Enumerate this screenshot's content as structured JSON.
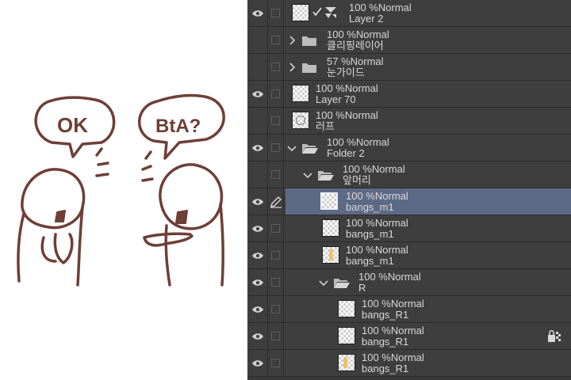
{
  "layers": [
    {
      "opacity": "100 %",
      "blend": "Normal",
      "name": "Layer 2"
    },
    {
      "opacity": "100 %",
      "blend": "Normal",
      "name": "클리핑레이어"
    },
    {
      "opacity": "57 %",
      "blend": "Normal",
      "name": "눈가이드"
    },
    {
      "opacity": "100 %",
      "blend": "Normal",
      "name": "Layer 70"
    },
    {
      "opacity": "100 %",
      "blend": "Normal",
      "name": "러프"
    },
    {
      "opacity": "100 %",
      "blend": "Normal",
      "name": "Folder 2"
    },
    {
      "opacity": "100 %",
      "blend": "Normal",
      "name": "앞머리"
    },
    {
      "opacity": "100 %",
      "blend": "Normal",
      "name": "bangs_m1"
    },
    {
      "opacity": "100 %",
      "blend": "Normal",
      "name": "bangs_m1"
    },
    {
      "opacity": "100 %",
      "blend": "Normal",
      "name": "bangs_m1"
    },
    {
      "opacity": "100 %",
      "blend": "Normal",
      "name": "R"
    },
    {
      "opacity": "100 %",
      "blend": "Normal",
      "name": "bangs_R1"
    },
    {
      "opacity": "100 %",
      "blend": "Normal",
      "name": "bangs_R1"
    },
    {
      "opacity": "100 %",
      "blend": "Normal",
      "name": "bangs_R1"
    }
  ],
  "canvas": {
    "speech_left": "OK",
    "speech_right": "BtA?"
  },
  "colors": {
    "panel_bg": "#3e3e3e",
    "selected_row": "#5d6a86",
    "ink": "#6e3f37"
  }
}
